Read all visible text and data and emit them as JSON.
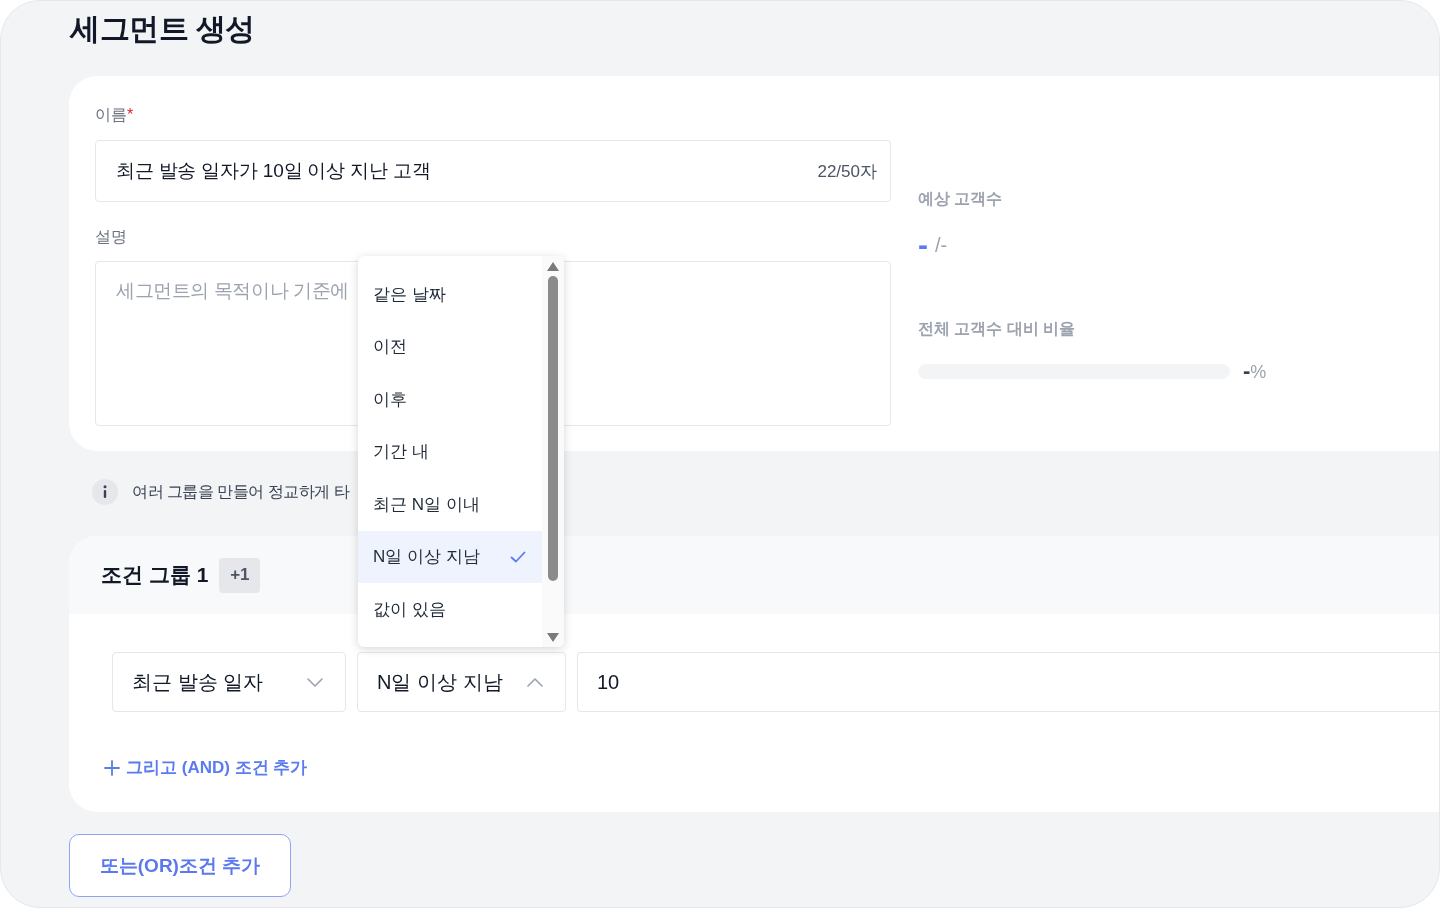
{
  "page": {
    "title": "세그먼트 생성"
  },
  "form": {
    "name_field": {
      "label": "이름",
      "required_mark": "*",
      "value": "최근 발송 일자가 10일 이상 지난 고객",
      "counter": "22/50자"
    },
    "description_field": {
      "label": "설명",
      "placeholder": "세그먼트의 목적이나 기준에"
    }
  },
  "estimate": {
    "label": "예상 고객수",
    "count": "-",
    "total": "/-",
    "ratio": {
      "label": "전체 고객수 대비 비율",
      "level": 0,
      "reading": "-",
      "unit": "%"
    }
  },
  "info": {
    "text": "여러 그룹을 만들어 정교하게 타"
  },
  "condition_groups": [
    {
      "title": "조건 그룹 1",
      "badge": "+1",
      "conditions": [
        {
          "field_select": {
            "value": "최근 발송 일자",
            "expanded": false
          },
          "operator_select": {
            "value": "N일 이상 지남",
            "expanded": true,
            "options": [
              {
                "label": "같은 날짜",
                "selected": false
              },
              {
                "label": "이전",
                "selected": false
              },
              {
                "label": "이후",
                "selected": false
              },
              {
                "label": "기간 내",
                "selected": false
              },
              {
                "label": "최근 N일 이내",
                "selected": false
              },
              {
                "label": "N일 이상 지남",
                "selected": true
              },
              {
                "label": "값이 있음",
                "selected": false
              }
            ]
          },
          "value_input": {
            "value": "10"
          }
        }
      ],
      "add_and_link": "그리고 (AND) 조건 추가"
    }
  ],
  "add_or_button": "또는(OR)조건 추가"
}
